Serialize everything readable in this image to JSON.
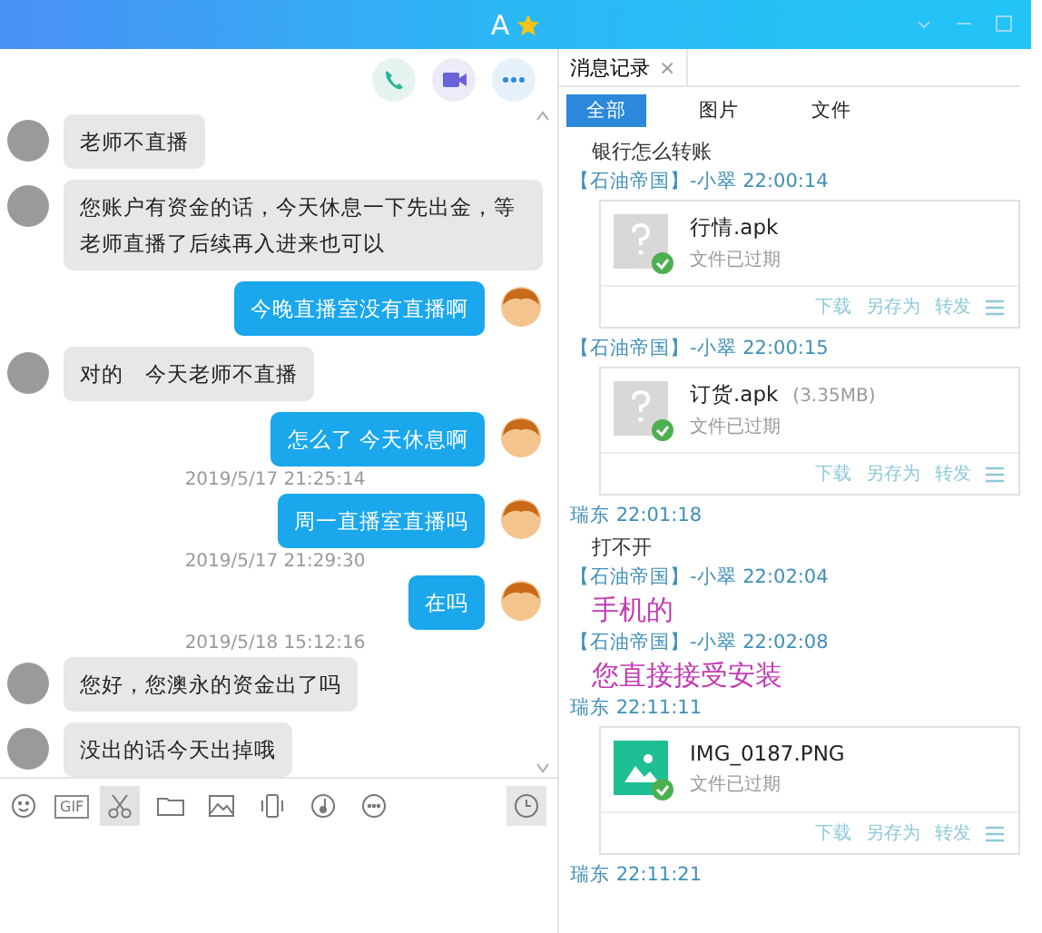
{
  "window": {
    "title": "A"
  },
  "chat": {
    "messages": [
      {
        "kind": "in",
        "text": "老师不直播"
      },
      {
        "kind": "in",
        "text": "您账户有资金的话，今天休息一下先出金，等老师直播了后续再入进来也可以"
      },
      {
        "kind": "out",
        "text": "今晚直播室没有直播啊"
      },
      {
        "kind": "in",
        "text": "对的　今天老师不直播"
      },
      {
        "kind": "out",
        "text": "怎么了 今天休息啊"
      },
      {
        "kind": "time",
        "text": "2019/5/17 21:25:14"
      },
      {
        "kind": "out",
        "text": "周一直播室直播吗"
      },
      {
        "kind": "time",
        "text": "2019/5/17 21:29:30"
      },
      {
        "kind": "out",
        "text": "在吗"
      },
      {
        "kind": "time",
        "text": "2019/5/18 15:12:16"
      },
      {
        "kind": "in",
        "text": "您好，您澳永的资金出了吗"
      },
      {
        "kind": "in",
        "text": "没出的话今天出掉哦"
      }
    ]
  },
  "toolbar": [
    {
      "kind": "emoji",
      "selected": false
    },
    {
      "kind": "gif",
      "label": "GIF",
      "selected": false
    },
    {
      "kind": "scissors",
      "selected": true
    },
    {
      "kind": "folder",
      "selected": false
    },
    {
      "kind": "image",
      "selected": false
    },
    {
      "kind": "shake",
      "selected": false
    },
    {
      "kind": "music",
      "selected": false
    },
    {
      "kind": "more",
      "selected": false
    }
  ],
  "history": {
    "tab": "消息记录",
    "tab_close": "×",
    "filters": [
      {
        "label": "全部",
        "selected": true
      },
      {
        "label": "图片",
        "selected": false
      },
      {
        "label": "文件",
        "selected": false
      }
    ],
    "items": [
      {
        "kind": "text",
        "text": "银行怎么转账"
      },
      {
        "kind": "header",
        "sender": "【石油帝国】-小翠",
        "time": "22:00:14"
      },
      {
        "kind": "file",
        "name": "行情.apk",
        "status": "文件已过期",
        "actions": [
          "下载",
          "另存为",
          "转发"
        ]
      },
      {
        "kind": "header",
        "sender": "【石油帝国】-小翠",
        "time": "22:00:15"
      },
      {
        "kind": "file",
        "name": "订货.apk",
        "size": "(3.35MB)",
        "status": "文件已过期",
        "actions": [
          "下载",
          "另存为",
          "转发"
        ]
      },
      {
        "kind": "header",
        "sender": "瑞东",
        "time": "22:01:18"
      },
      {
        "kind": "text",
        "text": "打不开"
      },
      {
        "kind": "header",
        "sender": "【石油帝国】-小翠",
        "time": "22:02:04"
      },
      {
        "kind": "big",
        "text": "手机的"
      },
      {
        "kind": "header",
        "sender": "【石油帝国】-小翠",
        "time": "22:02:08"
      },
      {
        "kind": "big",
        "text": "您直接接受安装"
      },
      {
        "kind": "header",
        "sender": "瑞东",
        "time": "22:11:11"
      },
      {
        "kind": "imagefile",
        "name": "IMG_0187.PNG",
        "status": "文件已过期",
        "actions": [
          "下载",
          "另存为",
          "转发"
        ]
      },
      {
        "kind": "header",
        "sender": "瑞东",
        "time": "22:11:21"
      }
    ]
  }
}
